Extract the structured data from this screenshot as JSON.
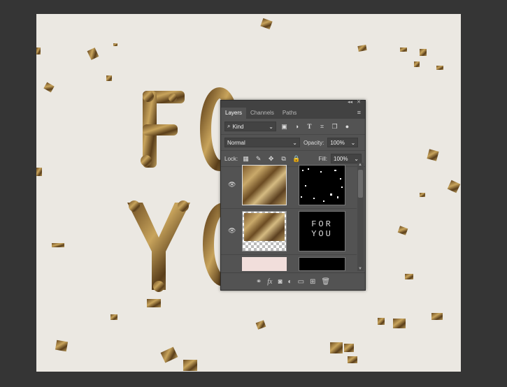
{
  "canvas": {
    "letters": [
      "F",
      "O",
      "Y",
      "O"
    ]
  },
  "panel": {
    "tabs": [
      "Layers",
      "Channels",
      "Paths"
    ],
    "filter_kind": "Kind",
    "blend_mode": "Normal",
    "opacity_label": "Opacity:",
    "opacity_value": "100%",
    "lock_label": "Lock:",
    "fill_label": "Fill:",
    "fill_value": "100%",
    "mask_text": [
      "FOR",
      "YOU"
    ]
  },
  "icons": [
    "search-icon",
    "image-filter-icon",
    "adjustment-filter-icon",
    "type-filter-icon",
    "shape-filter-icon",
    "smart-object-filter-icon",
    "eye-icon",
    "link-icon",
    "fx-icon",
    "mask-icon",
    "new-group-icon",
    "new-layer-icon",
    "trash-icon"
  ]
}
